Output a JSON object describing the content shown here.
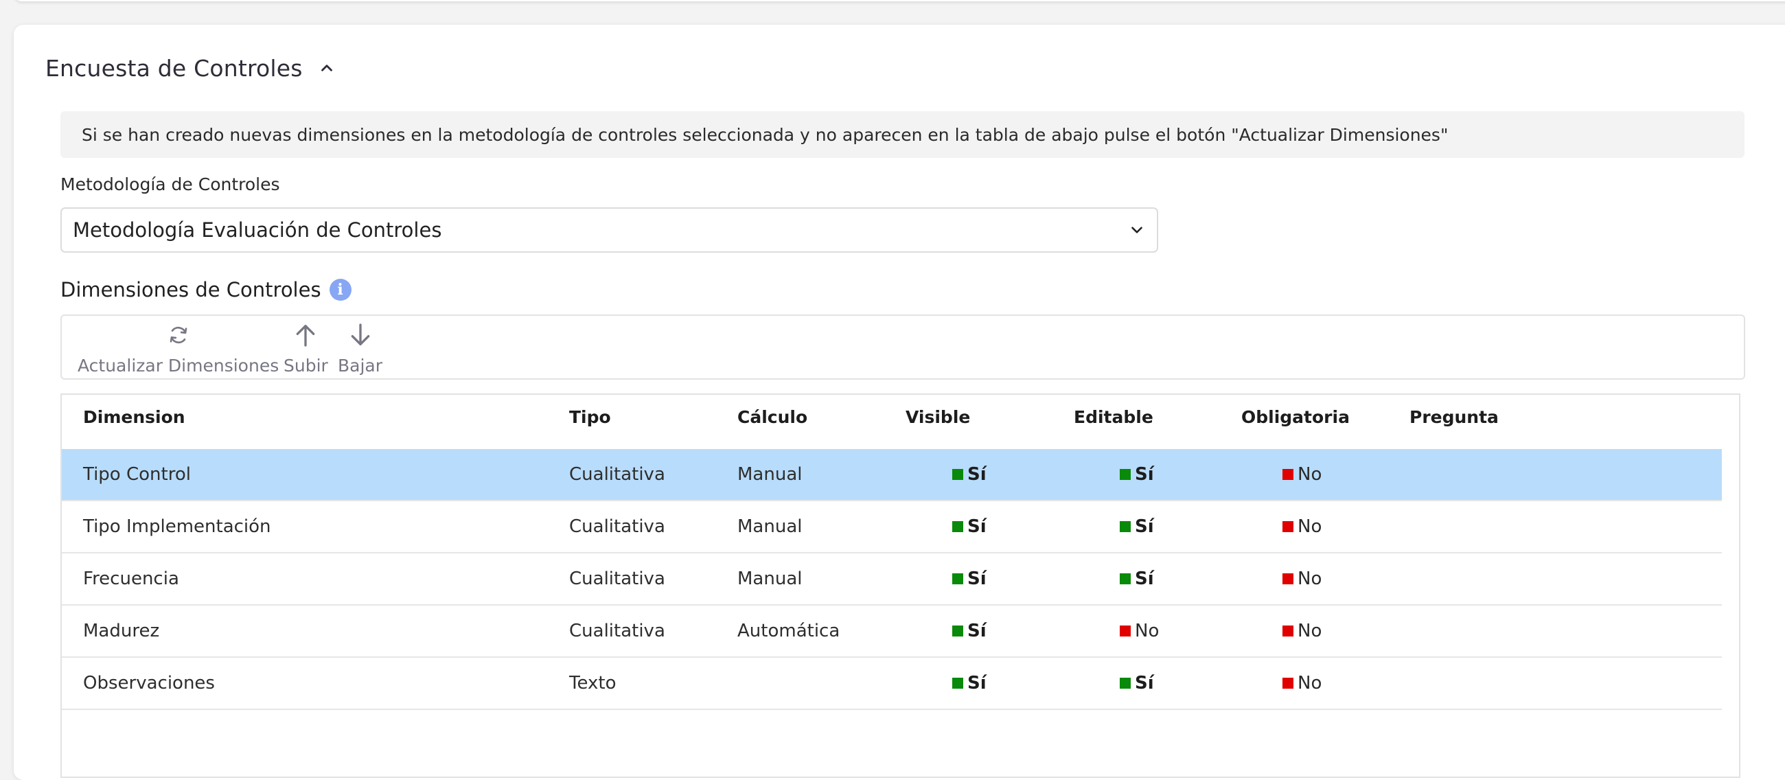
{
  "section": {
    "title": "Encuesta de Controles",
    "toggle_icon": "chevron-up-icon"
  },
  "banner": {
    "text": "Si se han creado nuevas dimensiones en la metodología de controles seleccionada y no aparecen en la tabla de abajo pulse el botón \"Actualizar Dimensiones\""
  },
  "methodology": {
    "label": "Metodología de Controles",
    "selected": "Metodología Evaluación de Controles"
  },
  "dimensions": {
    "title": "Dimensiones de Controles",
    "info_icon": "info-icon",
    "toolbar": {
      "refresh_label": "Actualizar Dimensiones",
      "up_label": "Subir",
      "down_label": "Bajar"
    },
    "columns": [
      "Dimension",
      "Tipo",
      "Cálculo",
      "Visible",
      "Editable",
      "Obligatoria",
      "Pregunta"
    ],
    "rows": [
      {
        "dimension": "Tipo Control",
        "tipo": "Cualitativa",
        "calculo": "Manual",
        "visible": "Sí",
        "editable": "Sí",
        "obligatoria": "No",
        "pregunta": "",
        "selected": true
      },
      {
        "dimension": "Tipo Implementación",
        "tipo": "Cualitativa",
        "calculo": "Manual",
        "visible": "Sí",
        "editable": "Sí",
        "obligatoria": "No",
        "pregunta": "",
        "selected": false
      },
      {
        "dimension": "Frecuencia",
        "tipo": "Cualitativa",
        "calculo": "Manual",
        "visible": "Sí",
        "editable": "Sí",
        "obligatoria": "No",
        "pregunta": "",
        "selected": false
      },
      {
        "dimension": "Madurez",
        "tipo": "Cualitativa",
        "calculo": "Automática",
        "visible": "Sí",
        "editable": "No",
        "obligatoria": "No",
        "pregunta": "",
        "selected": false
      },
      {
        "dimension": "Observaciones",
        "tipo": "Texto",
        "calculo": "",
        "visible": "Sí",
        "editable": "Sí",
        "obligatoria": "No",
        "pregunta": "",
        "selected": false
      }
    ]
  },
  "colors": {
    "yes": "#0a8a0a",
    "no": "#e00000",
    "selected_row": "#b8dcfb",
    "info_icon": "#87a6f4"
  }
}
